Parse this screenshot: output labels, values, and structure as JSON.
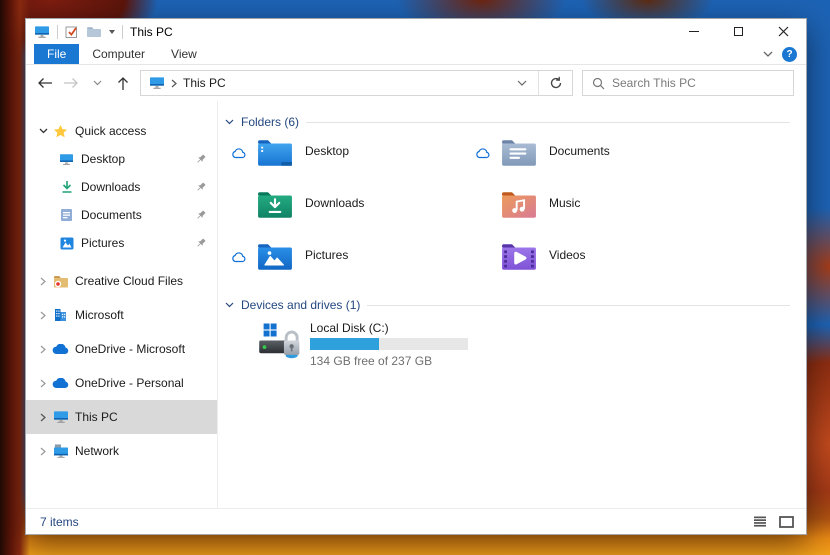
{
  "titlebar": {
    "title": "This PC"
  },
  "ribbon": {
    "tabs": [
      {
        "label": "File"
      },
      {
        "label": "Computer"
      },
      {
        "label": "View"
      }
    ],
    "help_glyph": "?"
  },
  "navbar": {
    "breadcrumb_root": "This PC",
    "search_placeholder": "Search This PC"
  },
  "sidebar": {
    "quick_access": {
      "label": "Quick access",
      "items": [
        {
          "label": "Desktop",
          "pinned": true
        },
        {
          "label": "Downloads",
          "pinned": true
        },
        {
          "label": "Documents",
          "pinned": true
        },
        {
          "label": "Pictures",
          "pinned": true
        }
      ]
    },
    "roots": [
      {
        "label": "Creative Cloud Files"
      },
      {
        "label": "Microsoft"
      },
      {
        "label": "OneDrive - Microsoft"
      },
      {
        "label": "OneDrive - Personal"
      },
      {
        "label": "This PC",
        "selected": true
      },
      {
        "label": "Network"
      }
    ]
  },
  "content": {
    "folders_group": {
      "label": "Folders (6)",
      "tiles": [
        {
          "name": "Desktop",
          "cloud_status": true
        },
        {
          "name": "Documents",
          "cloud_status": true
        },
        {
          "name": "Downloads",
          "cloud_status": false
        },
        {
          "name": "Music",
          "cloud_status": false
        },
        {
          "name": "Pictures",
          "cloud_status": true
        },
        {
          "name": "Videos",
          "cloud_status": false
        }
      ]
    },
    "drives_group": {
      "label": "Devices and drives (1)",
      "drive": {
        "name": "Local Disk (C:)",
        "free_text": "134 GB free of 237 GB",
        "used_percent": 43.5
      }
    }
  },
  "statusbar": {
    "items_count": "7 items"
  },
  "colors": {
    "accent_blue": "#1a77d2",
    "header_navy": "#24477f",
    "progress_fill": "#2ea0dc",
    "selected_gray": "#d9d9d9"
  }
}
